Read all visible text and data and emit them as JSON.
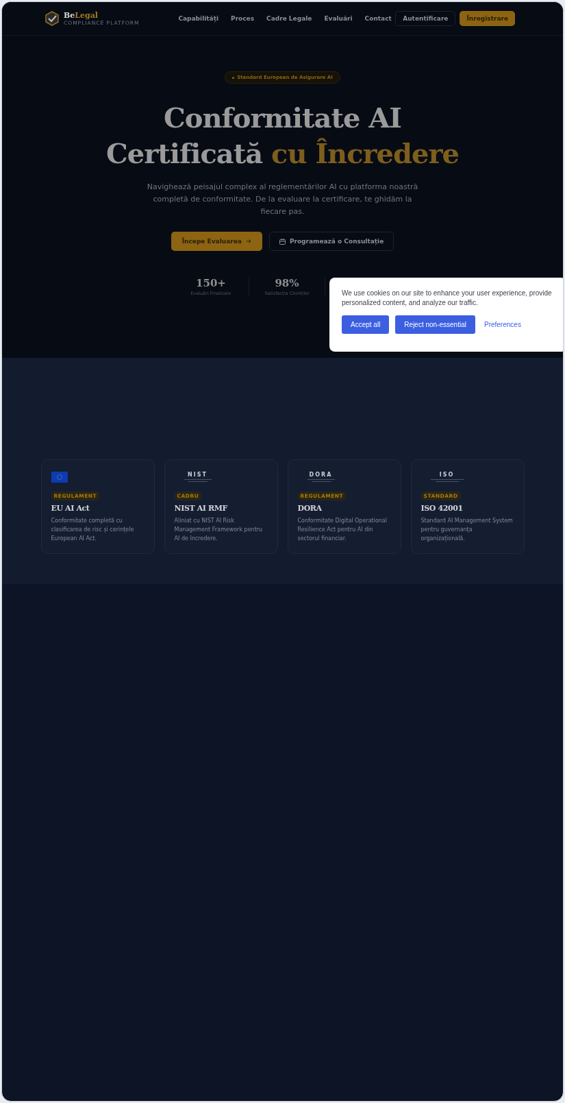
{
  "header": {
    "brand": {
      "part1": "Be",
      "part2": "Legal",
      "tagline": "COMPLIANCE PLATFORM"
    },
    "nav": [
      {
        "label": "Capabilități"
      },
      {
        "label": "Proces"
      },
      {
        "label": "Cadre Legale"
      },
      {
        "label": "Evaluări"
      },
      {
        "label": "Contact"
      }
    ],
    "login": "Autentificare",
    "register": "Înregistrare"
  },
  "hero": {
    "badge": "Standard European de Asigurare AI",
    "title_line1": "Conformitate AI",
    "title_line2_plain": "Certificată",
    "title_line2_accent": "cu Încredere",
    "description": "Navighează peisajul complex al reglementărilor AI cu platforma noastră completă de conformitate. De la evaluare la certificare, te ghidăm la fiecare pas.",
    "primary_button": "Începe Evaluarea",
    "secondary_button": "Programează o Consultație",
    "stats": [
      {
        "value": "150+",
        "label": "Evaluări Finalizate"
      },
      {
        "value": "98%",
        "label": "Satisfacția Clienților"
      }
    ]
  },
  "frameworks": [
    {
      "kind": "flag",
      "tag": "REGULAMENT",
      "title": "EU AI Act",
      "description": "Conformitate completă cu clasificarea de risc și cerințele European AI Act."
    },
    {
      "kind": "wordmark",
      "logo_text": "NIST",
      "tag": "CADRU",
      "title": "NIST AI RMF",
      "description": "Aliniat cu NIST AI Risk Management Framework pentru AI de încredere."
    },
    {
      "kind": "wordmark",
      "logo_text": "DORA",
      "tag": "REGULAMENT",
      "title": "DORA",
      "description": "Conformitate Digital Operational Resilience Act pentru AI din sectorul financiar."
    },
    {
      "kind": "wordmark",
      "logo_text": "ISO",
      "tag": "STANDARD",
      "title": "ISO 42001",
      "description": "Standard AI Management System pentru guvernanța organizațională."
    }
  ],
  "cookie_banner": {
    "message": "We use cookies on our site to enhance your user experience, provide personalized content, and analyze our traffic.",
    "accept": "Accept all",
    "reject": "Reject non-essential",
    "preferences": "Preferences"
  }
}
